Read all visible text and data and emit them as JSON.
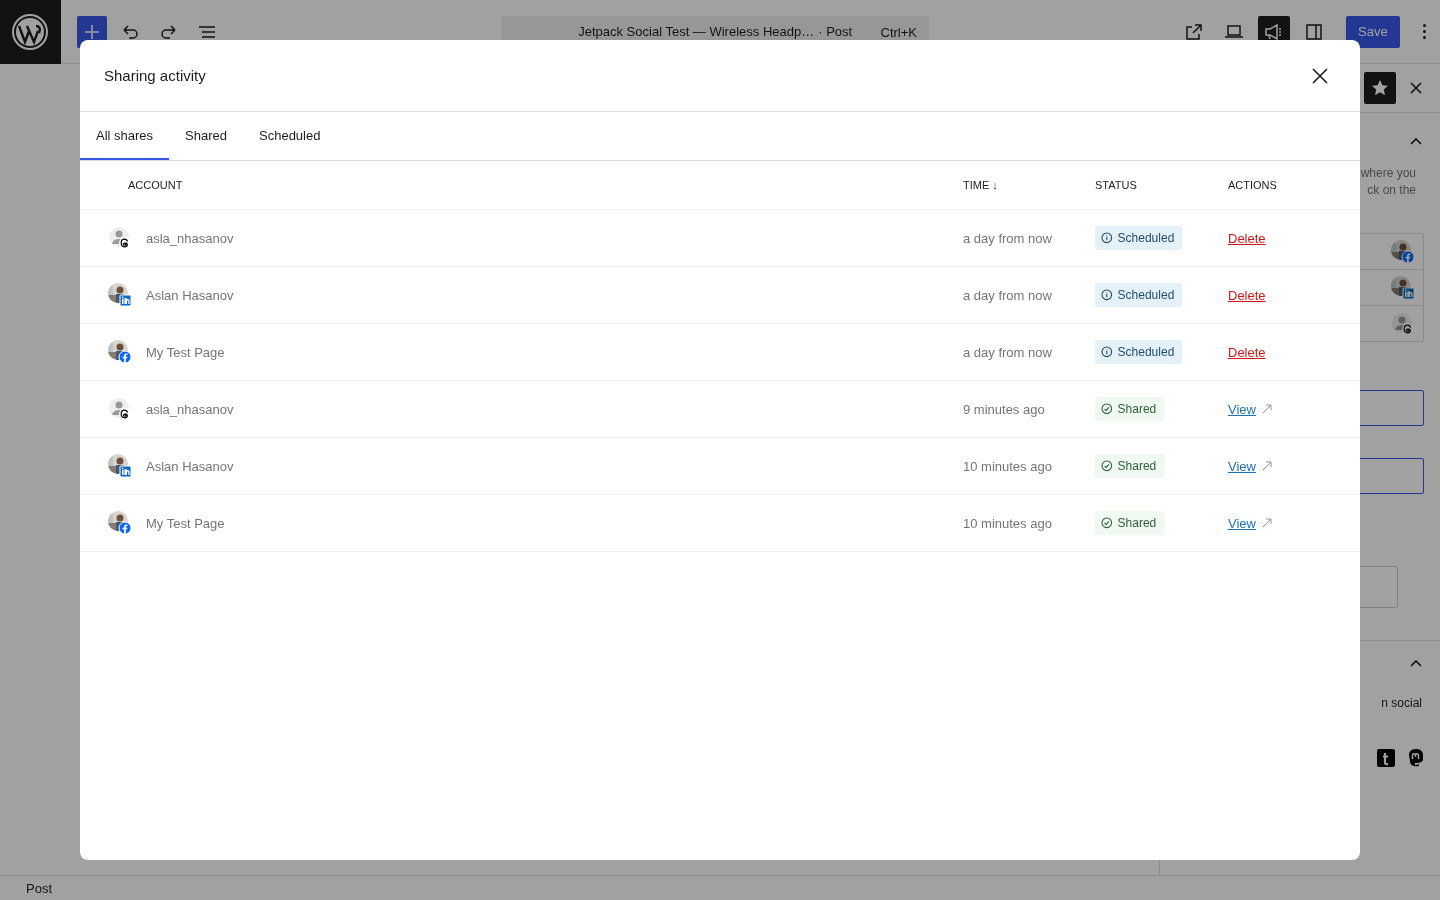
{
  "toolbar": {
    "add_pressed": true,
    "tools": [
      {
        "kind": "undo",
        "pressed": false
      },
      {
        "kind": "redo",
        "pressed": false
      },
      {
        "kind": "list",
        "pressed": false
      }
    ],
    "command": {
      "title": "Jetpack Social Test — Wireless Headp…",
      "type": "· Post",
      "shortcut": "Ctrl+K"
    },
    "right_tools": [
      {
        "kind": "external",
        "pressed": false
      },
      {
        "kind": "laptop",
        "pressed": false
      },
      {
        "kind": "megaphone",
        "pressed": true
      },
      {
        "kind": "sidebar",
        "pressed": false
      }
    ],
    "save": "Save"
  },
  "sidebar": {
    "text_lines": [
      "where you",
      "ck on the"
    ],
    "accounts": [
      {
        "network": {
          "kind": "facebook"
        }
      },
      {
        "network": {
          "kind": "linkedin"
        }
      },
      {
        "network": {
          "kind": "threads"
        },
        "avatar": {
          "kind": "default"
        }
      }
    ],
    "second_text": "n social",
    "services": [
      {
        "kind": "tumblr"
      },
      {
        "kind": "mastodon"
      }
    ]
  },
  "modal": {
    "title": "Sharing activity",
    "tabs": [
      {
        "label": "All shares",
        "selected": true
      },
      {
        "label": "Shared",
        "selected": false
      },
      {
        "label": "Scheduled",
        "selected": false
      }
    ],
    "columns": [
      "ACCOUNT",
      "TIME ↓",
      "STATUS",
      "ACTIONS"
    ],
    "rows": [
      {
        "account": "asla_nhasanov",
        "network": {
          "kind": "threads"
        },
        "avatar": {
          "kind": "default"
        },
        "time": "a day from now",
        "status": {
          "kind": "scheduled",
          "label": "Scheduled"
        },
        "action": {
          "kind": "delete",
          "label": "Delete"
        }
      },
      {
        "account": "Aslan Hasanov",
        "network": {
          "kind": "linkedin"
        },
        "time": "a day from now",
        "status": {
          "kind": "scheduled",
          "label": "Scheduled"
        },
        "action": {
          "kind": "delete",
          "label": "Delete"
        }
      },
      {
        "account": "My Test Page",
        "network": {
          "kind": "facebook"
        },
        "time": "a day from now",
        "status": {
          "kind": "scheduled",
          "label": "Scheduled"
        },
        "action": {
          "kind": "delete",
          "label": "Delete"
        }
      },
      {
        "account": "asla_nhasanov",
        "network": {
          "kind": "threads"
        },
        "avatar": {
          "kind": "default"
        },
        "time": "9 minutes ago",
        "status": {
          "kind": "shared",
          "label": "Shared"
        },
        "action": {
          "kind": "view",
          "label": "View"
        }
      },
      {
        "account": "Aslan Hasanov",
        "network": {
          "kind": "linkedin"
        },
        "time": "10 minutes ago",
        "status": {
          "kind": "shared",
          "label": "Shared"
        },
        "action": {
          "kind": "view",
          "label": "View"
        }
      },
      {
        "account": "My Test Page",
        "network": {
          "kind": "facebook"
        },
        "time": "10 minutes ago",
        "status": {
          "kind": "shared",
          "label": "Shared"
        },
        "action": {
          "kind": "view",
          "label": "View"
        }
      }
    ]
  },
  "status_bar": "Post"
}
